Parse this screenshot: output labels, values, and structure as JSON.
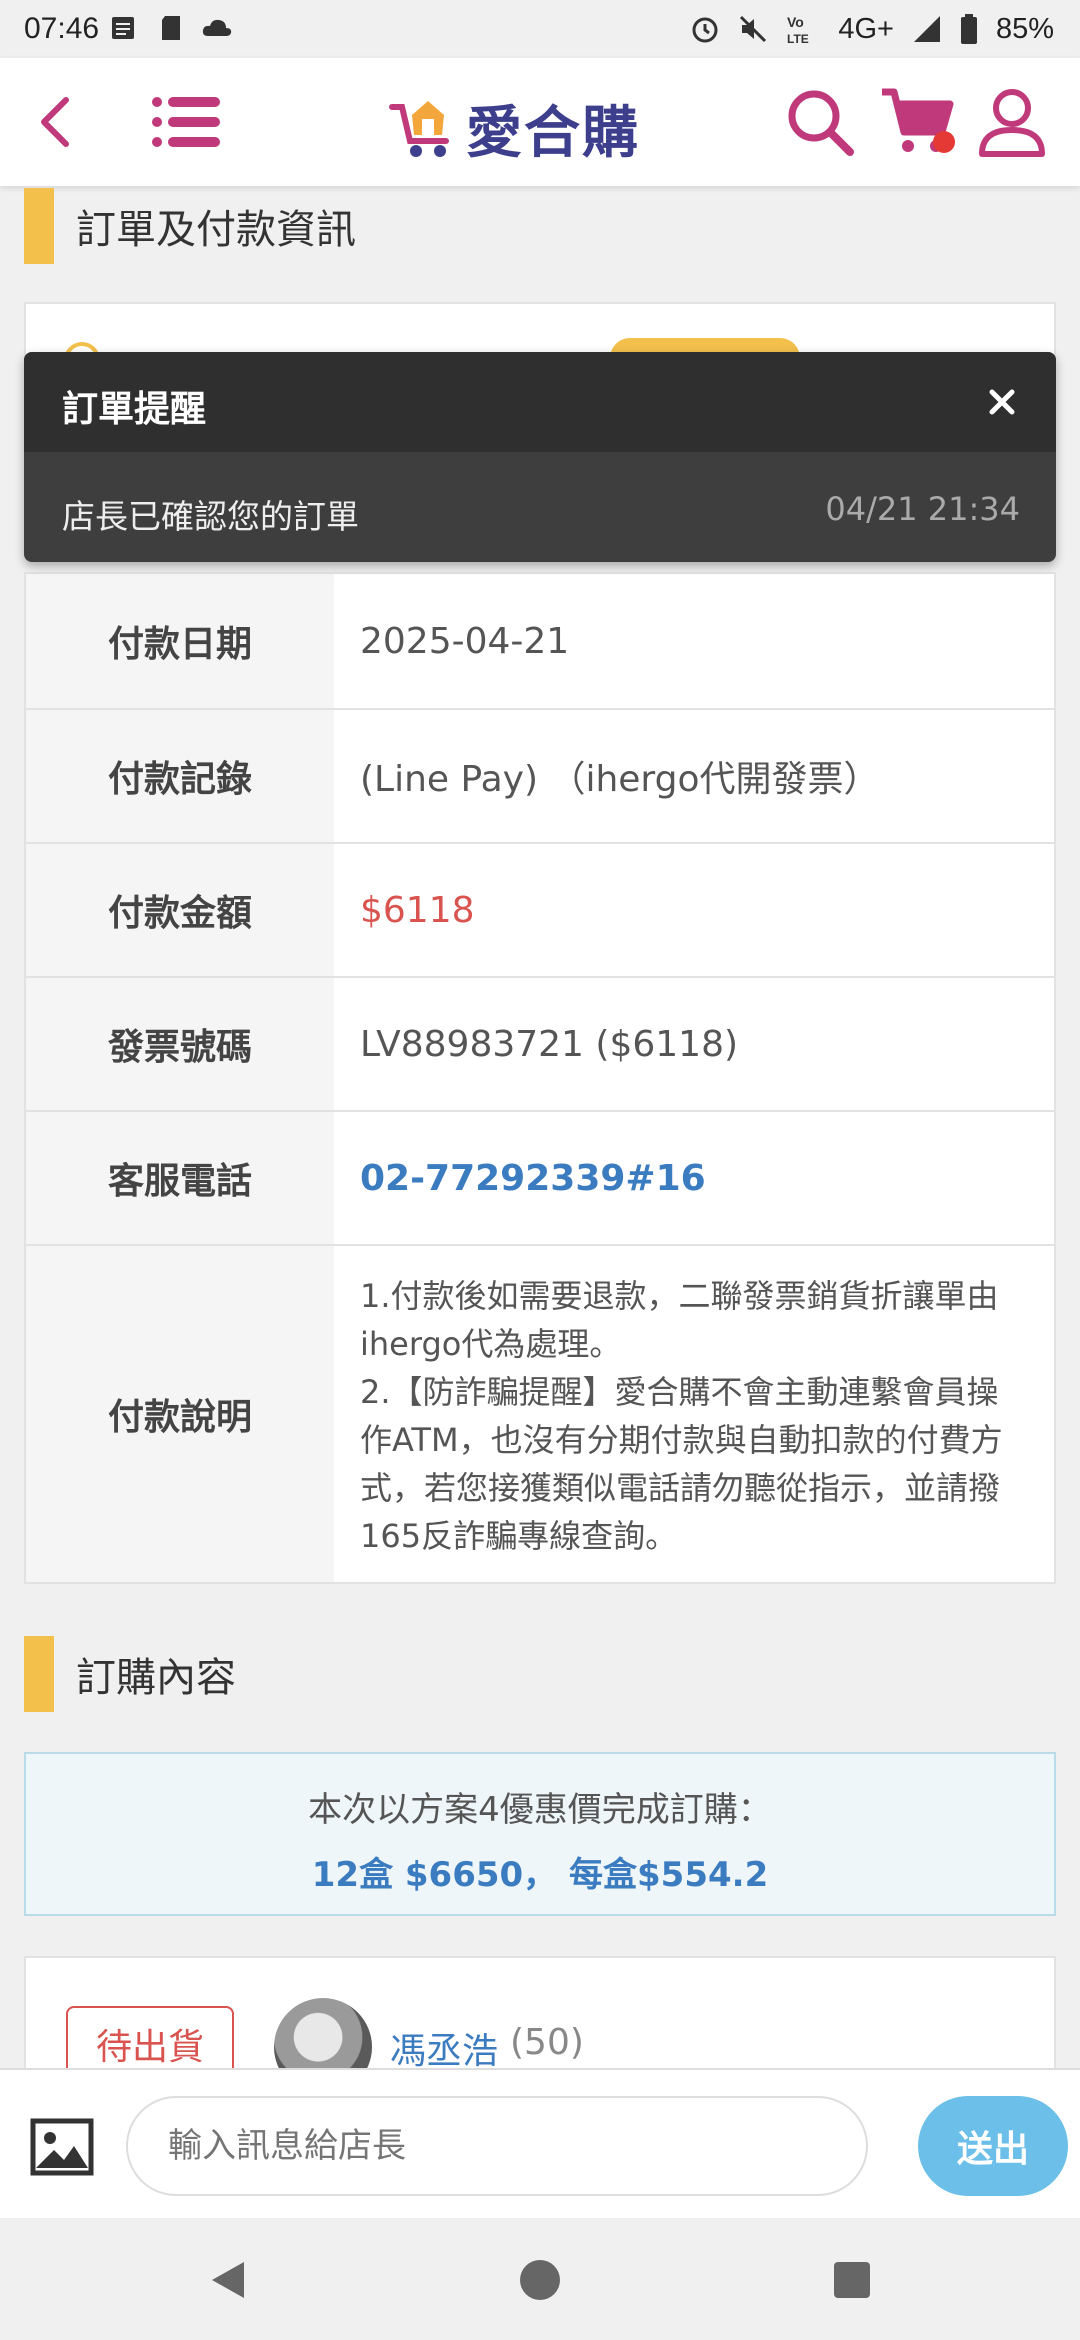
{
  "status_bar": {
    "time": "07:46",
    "network": "4G+",
    "battery": "85%"
  },
  "header": {
    "logo_text": "愛合購",
    "brand_color": "#c0397a",
    "logo_color": "#3d3e8c"
  },
  "section_payment": {
    "title": "訂單及付款資訊"
  },
  "toast": {
    "title": "訂單提醒",
    "message": "店長已確認您的訂單",
    "time": "04/21 21:34"
  },
  "payment_rows": [
    {
      "label": "付款日期",
      "value": "2025-04-21"
    },
    {
      "label": "付款記錄",
      "value": "(Line Pay) （ihergo代開發票）"
    },
    {
      "label": "付款金額",
      "value": "$6118"
    },
    {
      "label": "發票號碼",
      "value": "LV88983721 ($6118)"
    },
    {
      "label": "客服電話",
      "value": "02-77292339#16"
    },
    {
      "label": "付款說明",
      "value_lines": [
        "1.付款後如需要退款，二聯發票銷貨折讓單由ihergo代為處理。",
        "2.【防詐騙提醒】愛合購不會主動連繫會員操作ATM，也沒有分期付款與自動扣款的付費方式，若您接獲類似電話請勿聽從指示，並請撥165反詐騙專線查詢。"
      ]
    }
  ],
  "section_order": {
    "title": "訂購內容"
  },
  "promo": {
    "line1": "本次以方案4優惠價完成訂購：",
    "line2": "12盒 $6650， 每盒$554.2"
  },
  "seller": {
    "badge": "待出貨",
    "name": "馮丞浩",
    "count": "(50)"
  },
  "message_bar": {
    "placeholder": "輸入訊息給店長",
    "send_label": "送出"
  },
  "colors": {
    "accent_yellow": "#f2c04b",
    "price_red": "#d9534f",
    "link_blue": "#3b7bc0",
    "send_blue": "#6bbfe8"
  }
}
